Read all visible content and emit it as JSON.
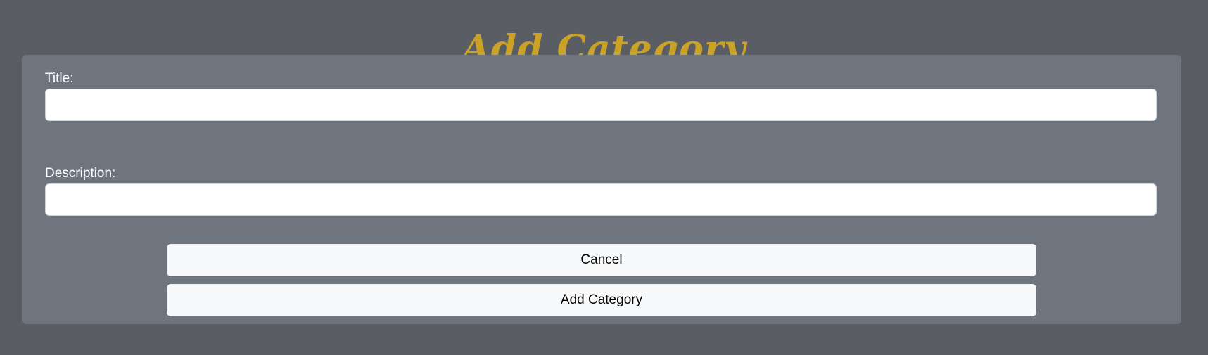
{
  "page": {
    "title": "Add Category"
  },
  "form": {
    "title_label": "Title:",
    "title_value": "",
    "title_placeholder": "",
    "description_label": "Description:",
    "description_value": "",
    "description_placeholder": ""
  },
  "actions": {
    "cancel_label": "Cancel",
    "submit_label": "Add Category"
  },
  "colors": {
    "background": "#5a5d64",
    "panel": "#6e757f",
    "title_accent": "#c9a227",
    "button_background": "#f8f9fa",
    "input_background": "#ffffff",
    "label_text": "#ffffff"
  }
}
